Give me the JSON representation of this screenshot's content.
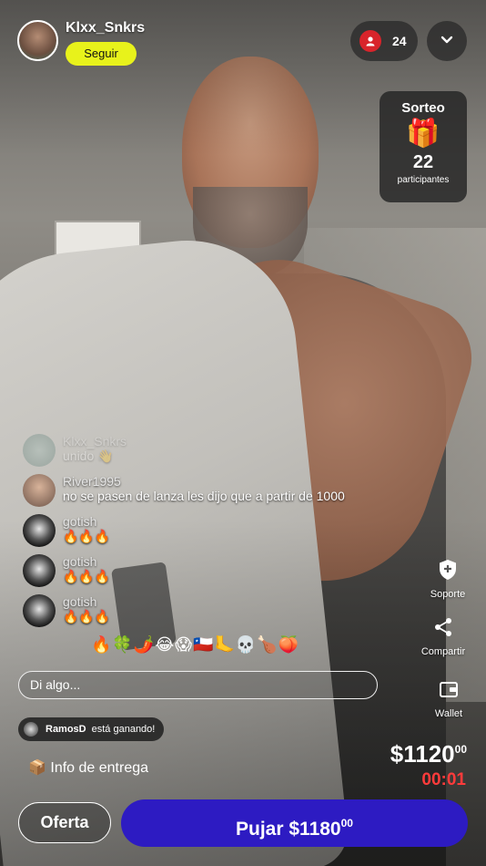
{
  "host": {
    "name": "Klxx_Snkrs",
    "follow_label": "Seguir"
  },
  "viewers": {
    "count": "24",
    "icon": "person-icon"
  },
  "giveaway": {
    "title": "Sorteo",
    "count": "22",
    "subtitle": "participantes",
    "icon": "gift-icon"
  },
  "chat": [
    {
      "user": "Klxx_Snkrs",
      "message": "unido 👋"
    },
    {
      "user": "River1995",
      "message": "no se pasen de lanza les dijo que a partir de 1000"
    },
    {
      "user": "gotish",
      "message": "🔥🔥🔥"
    },
    {
      "user": "gotish",
      "message": "🔥🔥🔥"
    },
    {
      "user": "gotish",
      "message": "🔥🔥🔥"
    }
  ],
  "reactions": "🔥🍀🌶️😂😱🇨🇱🦶💀🍗🍑",
  "input": {
    "placeholder": "Di algo..."
  },
  "winner": {
    "name": "RamosD",
    "text": "está ganando!"
  },
  "delivery": {
    "icon": "📦",
    "label": "Info de entrega"
  },
  "side": {
    "support": "Soporte",
    "share": "Compartir",
    "wallet": "Wallet"
  },
  "price": {
    "main": "$1120",
    "cents": "00"
  },
  "timer": "00:01",
  "buttons": {
    "offer": "Oferta",
    "bid_main": "Pujar $1180",
    "bid_cents": "00"
  },
  "colors": {
    "follow": "#e8f21b",
    "bid": "#2d1bc2",
    "timer": "#ff3b3b",
    "viewer_dot": "#d8242b"
  }
}
